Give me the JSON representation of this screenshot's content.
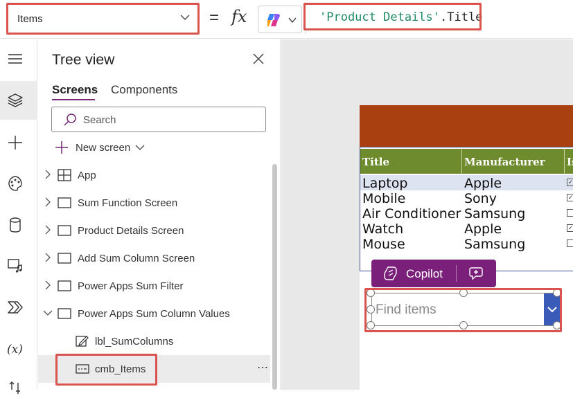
{
  "formula_bar": {
    "property": "Items",
    "equals": "=",
    "fx": "fx",
    "formula_string": "'Product Details'",
    "formula_suffix": ".Title"
  },
  "tree_view": {
    "title": "Tree view",
    "tabs": [
      "Screens",
      "Components"
    ],
    "search_placeholder": "Search",
    "new_screen": "New screen",
    "items": [
      {
        "label": "App"
      },
      {
        "label": "Sum Function Screen"
      },
      {
        "label": "Product Details Screen"
      },
      {
        "label": "Add Sum Column Screen"
      },
      {
        "label": "Power Apps Sum Filter"
      },
      {
        "label": "Power Apps Sum Column Values"
      },
      {
        "label": "lbl_SumColumns"
      },
      {
        "label": "cmb_Items",
        "more": "⋯"
      }
    ]
  },
  "canvas": {
    "table": {
      "headers": [
        "Title",
        "Manufacturer",
        "Is"
      ],
      "rows": [
        {
          "title": "Laptop",
          "manufacturer": "Apple",
          "checked": true
        },
        {
          "title": "Mobile",
          "manufacturer": "Sony",
          "checked": true
        },
        {
          "title": "Air Conditioner",
          "manufacturer": "Samsung",
          "checked": false
        },
        {
          "title": "Watch",
          "manufacturer": "Apple",
          "checked": true
        },
        {
          "title": "Mouse",
          "manufacturer": "Samsung",
          "checked": false
        }
      ]
    },
    "copilot_label": "Copilot",
    "combo_placeholder": "Find items"
  },
  "colors": {
    "accent": "#742774",
    "header_bar": "#a84010",
    "grid_header": "#6e8b2e",
    "copilot_pill": "#7a1f7a",
    "combo_button": "#3a5bb8",
    "highlight_box": "#d9534f"
  },
  "icons": {
    "rail": [
      "hamburger-icon",
      "layers-icon",
      "plus-icon",
      "palette-icon",
      "database-icon",
      "media-icon",
      "power-automate-icon",
      "variable-icon",
      "tools-icon"
    ]
  }
}
